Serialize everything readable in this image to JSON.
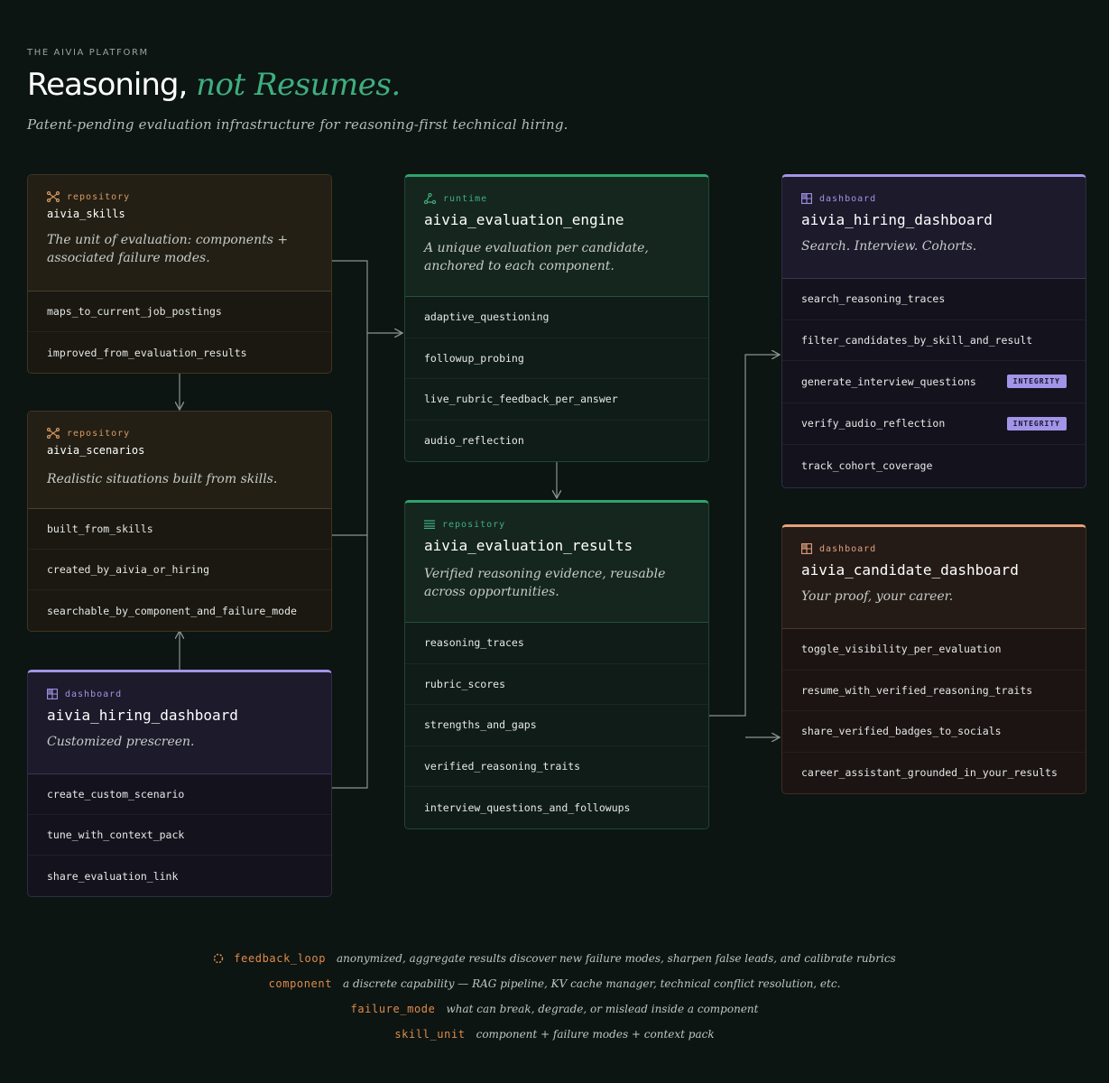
{
  "header": {
    "eyebrow": "THE AIVIA PLATFORM",
    "title_main": "Reasoning, ",
    "title_accent": "not Resumes.",
    "subtitle": "Patent-pending evaluation infrastructure for reasoning-first technical hiring."
  },
  "cards": {
    "skills": {
      "icon": "network-icon",
      "tag": "repository",
      "name": "aivia_skills",
      "desc": "The unit of evaluation: components + associated failure modes.",
      "items": [
        "maps_to_current_job_postings",
        "improved_from_evaluation_results"
      ]
    },
    "scenarios": {
      "icon": "network-icon",
      "tag": "repository",
      "name": "aivia_scenarios",
      "desc": "Realistic situations built from skills.",
      "items": [
        "built_from_skills",
        "created_by_aivia_or_hiring",
        "searchable_by_component_and_failure_mode"
      ]
    },
    "hiring_left": {
      "icon": "grid-dashboard-icon",
      "tag": "dashboard",
      "name": "aivia_hiring_dashboard",
      "desc": "Customized prescreen.",
      "items": [
        "create_custom_scenario",
        "tune_with_context_pack",
        "share_evaluation_link"
      ]
    },
    "engine": {
      "icon": "graph-nodes-icon",
      "tag": "runtime",
      "name": "aivia_evaluation_engine",
      "desc": "A unique evaluation per candidate, anchored to each component.",
      "items": [
        "adaptive_questioning",
        "followup_probing",
        "live_rubric_feedback_per_answer",
        "audio_reflection"
      ]
    },
    "results": {
      "icon": "list-lines-icon",
      "tag": "repository",
      "name": "aivia_evaluation_results",
      "desc": "Verified reasoning evidence, reusable across opportunities.",
      "items": [
        "reasoning_traces",
        "rubric_scores",
        "strengths_and_gaps",
        "verified_reasoning_traits",
        "interview_questions_and_followups"
      ]
    },
    "hiring_right": {
      "icon": "grid-dashboard-icon",
      "tag": "dashboard",
      "name": "aivia_hiring_dashboard",
      "desc": "Search. Interview. Cohorts.",
      "items": [
        "search_reasoning_traces",
        "filter_candidates_by_skill_and_result",
        "generate_interview_questions",
        "verify_audio_reflection",
        "track_cohort_coverage"
      ],
      "badges": [
        "",
        "",
        "INTEGRITY",
        "INTEGRITY",
        ""
      ]
    },
    "candidate": {
      "icon": "grid-dashboard-icon",
      "tag": "dashboard",
      "name": "aivia_candidate_dashboard",
      "desc": "Your proof, your career.",
      "items": [
        "toggle_visibility_per_evaluation",
        "resume_with_verified_reasoning_traits",
        "share_verified_badges_to_socials",
        "career_assistant_grounded_in_your_results"
      ]
    }
  },
  "glossary": [
    {
      "term": "feedback_loop",
      "def": "anonymized, aggregate results discover new failure modes, sharpen false leads, and calibrate rubrics",
      "icon": "loop-icon"
    },
    {
      "term": "component",
      "def": "a discrete capability — RAG pipeline, KV cache manager, technical conflict resolution, etc."
    },
    {
      "term": "failure_mode",
      "def": "what can break, degrade, or mislead inside a component"
    },
    {
      "term": "skill_unit",
      "def": "component + failure modes + context pack"
    }
  ],
  "colors": {
    "background": "#0c1512",
    "accent_green": "#3fae7f",
    "repository_orange": "#d99a61",
    "dashboard_purple": "#a294e6",
    "candidate_peach": "#e8a07a",
    "glossary_term": "#e08a4a"
  }
}
